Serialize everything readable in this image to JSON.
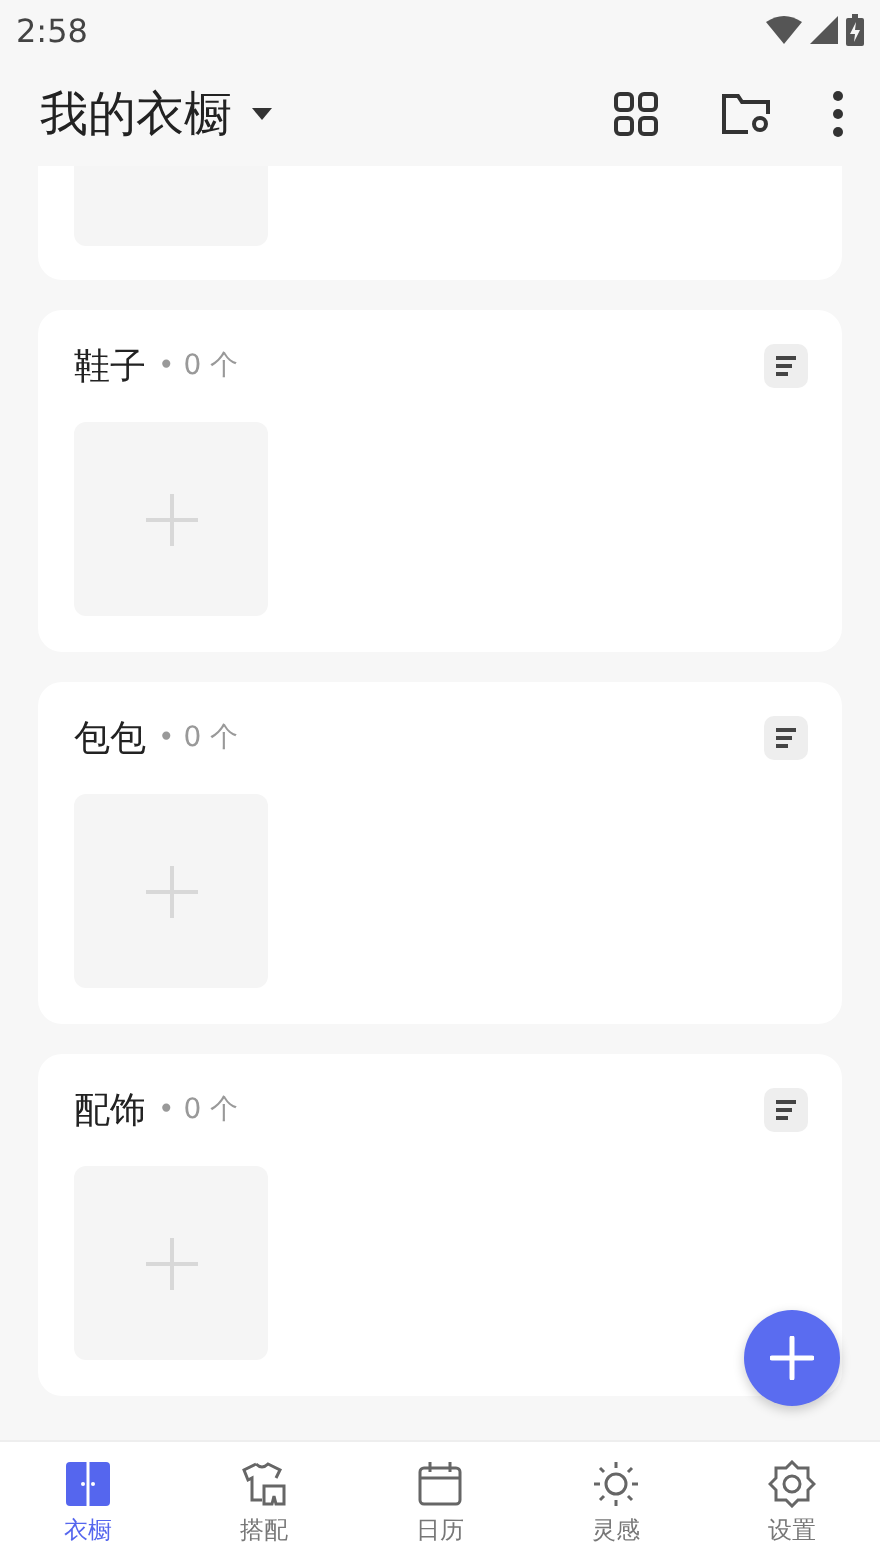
{
  "status_bar": {
    "time": "2:58"
  },
  "header": {
    "title": "我的衣橱"
  },
  "sections": [
    {
      "name": "鞋子",
      "count": "• 0 个"
    },
    {
      "name": "包包",
      "count": "• 0 个"
    },
    {
      "name": "配饰",
      "count": "• 0 个"
    }
  ],
  "tabs": [
    {
      "label": "衣橱",
      "kind": "wardrobe",
      "selected": true
    },
    {
      "label": "搭配",
      "kind": "outfit",
      "selected": false
    },
    {
      "label": "日历",
      "kind": "calendar",
      "selected": false
    },
    {
      "label": "灵感",
      "kind": "idea",
      "selected": false
    },
    {
      "label": "设置",
      "kind": "settings",
      "selected": false
    }
  ]
}
